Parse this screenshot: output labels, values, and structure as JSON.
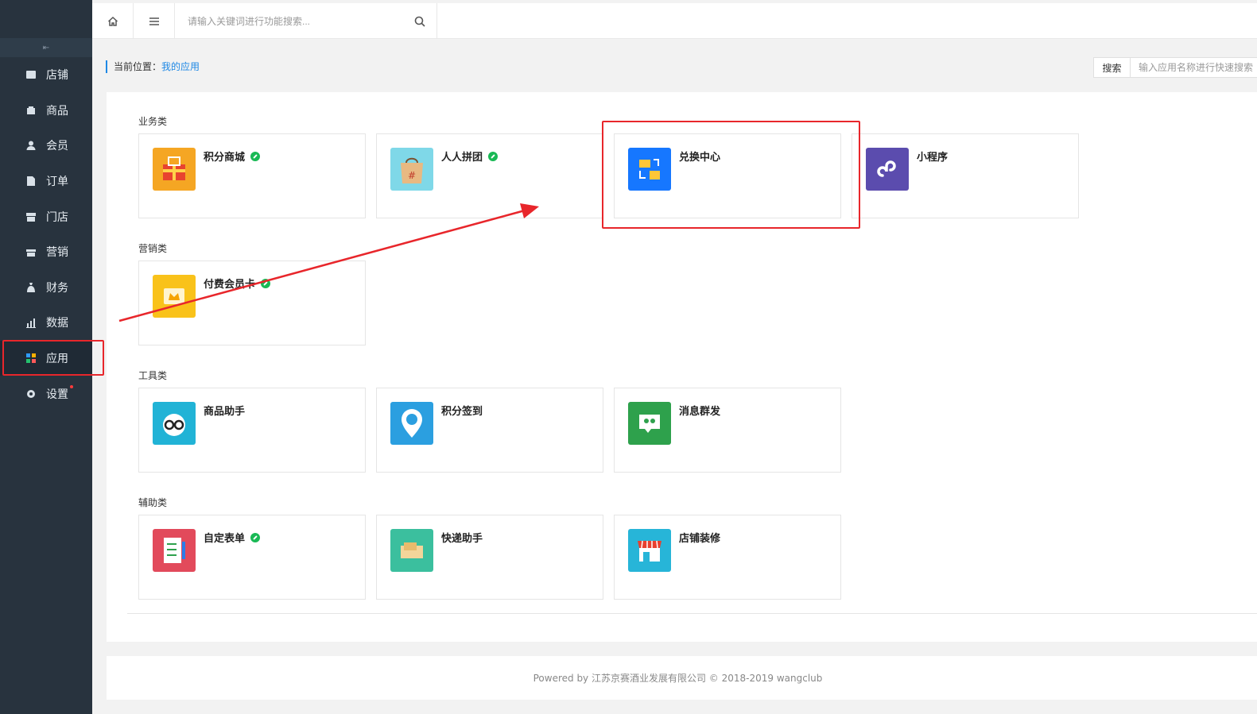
{
  "sidebar": {
    "collapse_icon": "collapse-icon",
    "items": [
      {
        "label": "店铺",
        "icon": "store-icon"
      },
      {
        "label": "商品",
        "icon": "goods-icon"
      },
      {
        "label": "会员",
        "icon": "member-icon"
      },
      {
        "label": "订单",
        "icon": "order-icon"
      },
      {
        "label": "门店",
        "icon": "shop-icon"
      },
      {
        "label": "营销",
        "icon": "gift-icon"
      },
      {
        "label": "财务",
        "icon": "money-bag-icon"
      },
      {
        "label": "数据",
        "icon": "chart-icon"
      },
      {
        "label": "应用",
        "icon": "apps-icon",
        "active": true
      },
      {
        "label": "设置",
        "icon": "gear-icon",
        "has_dot": true
      }
    ]
  },
  "topbar": {
    "search_placeholder": "请输入关键词进行功能搜索..."
  },
  "breadcrumb": {
    "prefix": "当前位置：",
    "current": "我的应用"
  },
  "quick_search": {
    "button": "搜索",
    "placeholder": "输入应用名称进行快速搜索"
  },
  "categories": [
    {
      "title": "业务类",
      "apps": [
        {
          "name": "积分商城",
          "linked": true,
          "icon": "points-mall-icon",
          "color": "#f5a623"
        },
        {
          "name": "人人拼团",
          "linked": true,
          "icon": "group-buy-icon",
          "color": "#7fd8e8"
        },
        {
          "name": "兑换中心",
          "linked": false,
          "icon": "exchange-icon",
          "color": "#1677ff"
        },
        {
          "name": "小程序",
          "linked": false,
          "icon": "mini-program-icon",
          "color": "#5b4cae"
        }
      ]
    },
    {
      "title": "营销类",
      "apps": [
        {
          "name": "付费会员卡",
          "linked": true,
          "icon": "vip-card-icon",
          "color": "#f9c21a"
        }
      ]
    },
    {
      "title": "工具类",
      "apps": [
        {
          "name": "商品助手",
          "linked": false,
          "icon": "goods-assistant-icon",
          "color": "#21b3d6"
        },
        {
          "name": "积分签到",
          "linked": false,
          "icon": "sign-in-icon",
          "color": "#2b9fe0"
        },
        {
          "name": "消息群发",
          "linked": false,
          "icon": "message-icon",
          "color": "#2ea14c"
        }
      ]
    },
    {
      "title": "辅助类",
      "apps": [
        {
          "name": "自定表单",
          "linked": true,
          "icon": "form-icon",
          "color": "#e24a5b"
        },
        {
          "name": "快递助手",
          "linked": false,
          "icon": "express-icon",
          "color": "#3bbf9e"
        },
        {
          "name": "店铺装修",
          "linked": false,
          "icon": "decoration-icon",
          "color": "#27b5d8"
        }
      ]
    }
  ],
  "footer": {
    "text": "Powered by 江苏京赛酒业发展有限公司 © 2018-2019 wangclub"
  },
  "annotation_color": "#e8262b"
}
